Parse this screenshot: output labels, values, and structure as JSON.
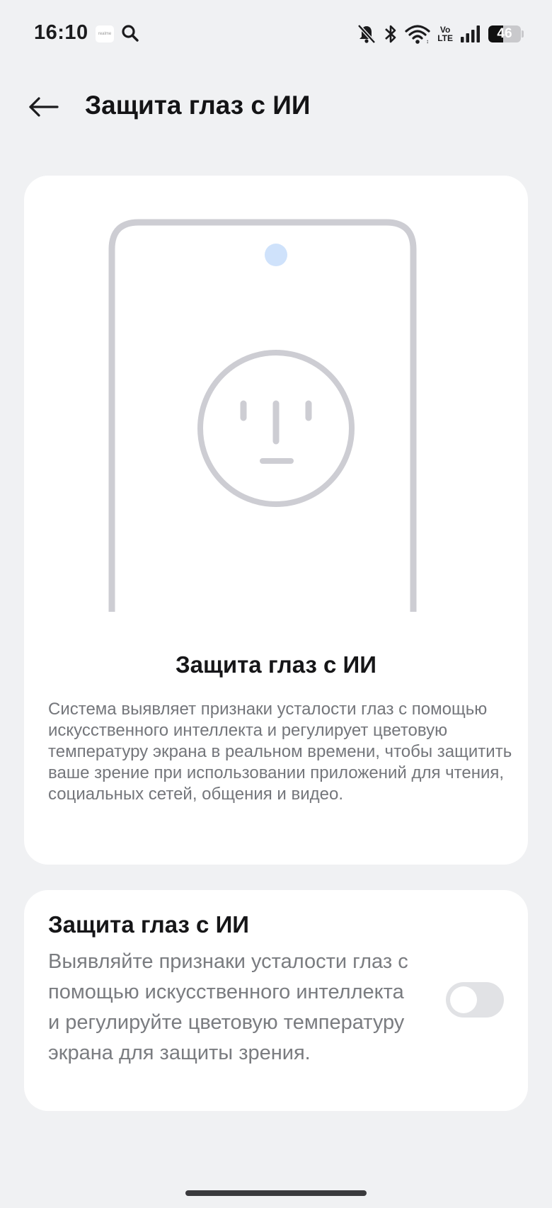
{
  "status_bar": {
    "time": "16:10",
    "app_icon_text": "realme",
    "battery_level": "46",
    "icons": [
      "mute-icon",
      "bluetooth-icon",
      "wifi-icon",
      "volte-icon",
      "signal-icon",
      "battery-icon"
    ],
    "volte_top": "Vo",
    "volte_bottom": "LTE"
  },
  "header": {
    "back_icon": "arrow-left-icon",
    "title": "Защита глаз с ИИ"
  },
  "hero": {
    "title": "Защита глаз с ИИ",
    "description": "Система выявляет признаки усталости глаз с помощью искусственного интеллекта и регулирует цветовую температуру экрана в реальном времени, чтобы защитить ваше зрение при использовании приложений для чтения, социальных сетей, общения и видео.",
    "colors": {
      "phone_outline": "#cdcdd3",
      "camera_dot": "#cfe2fb",
      "face": "#cdcdd3"
    }
  },
  "setting": {
    "title": "Защита глаз с ИИ",
    "description": "Выявляйте признаки усталости глаз с помощью искусственного интеллекта и регулируйте цветовую температуру экрана для защиты зрения.",
    "enabled": false
  },
  "colors": {
    "background": "#f0f1f3",
    "card": "#ffffff",
    "toggle_off": "#e1e2e5"
  }
}
